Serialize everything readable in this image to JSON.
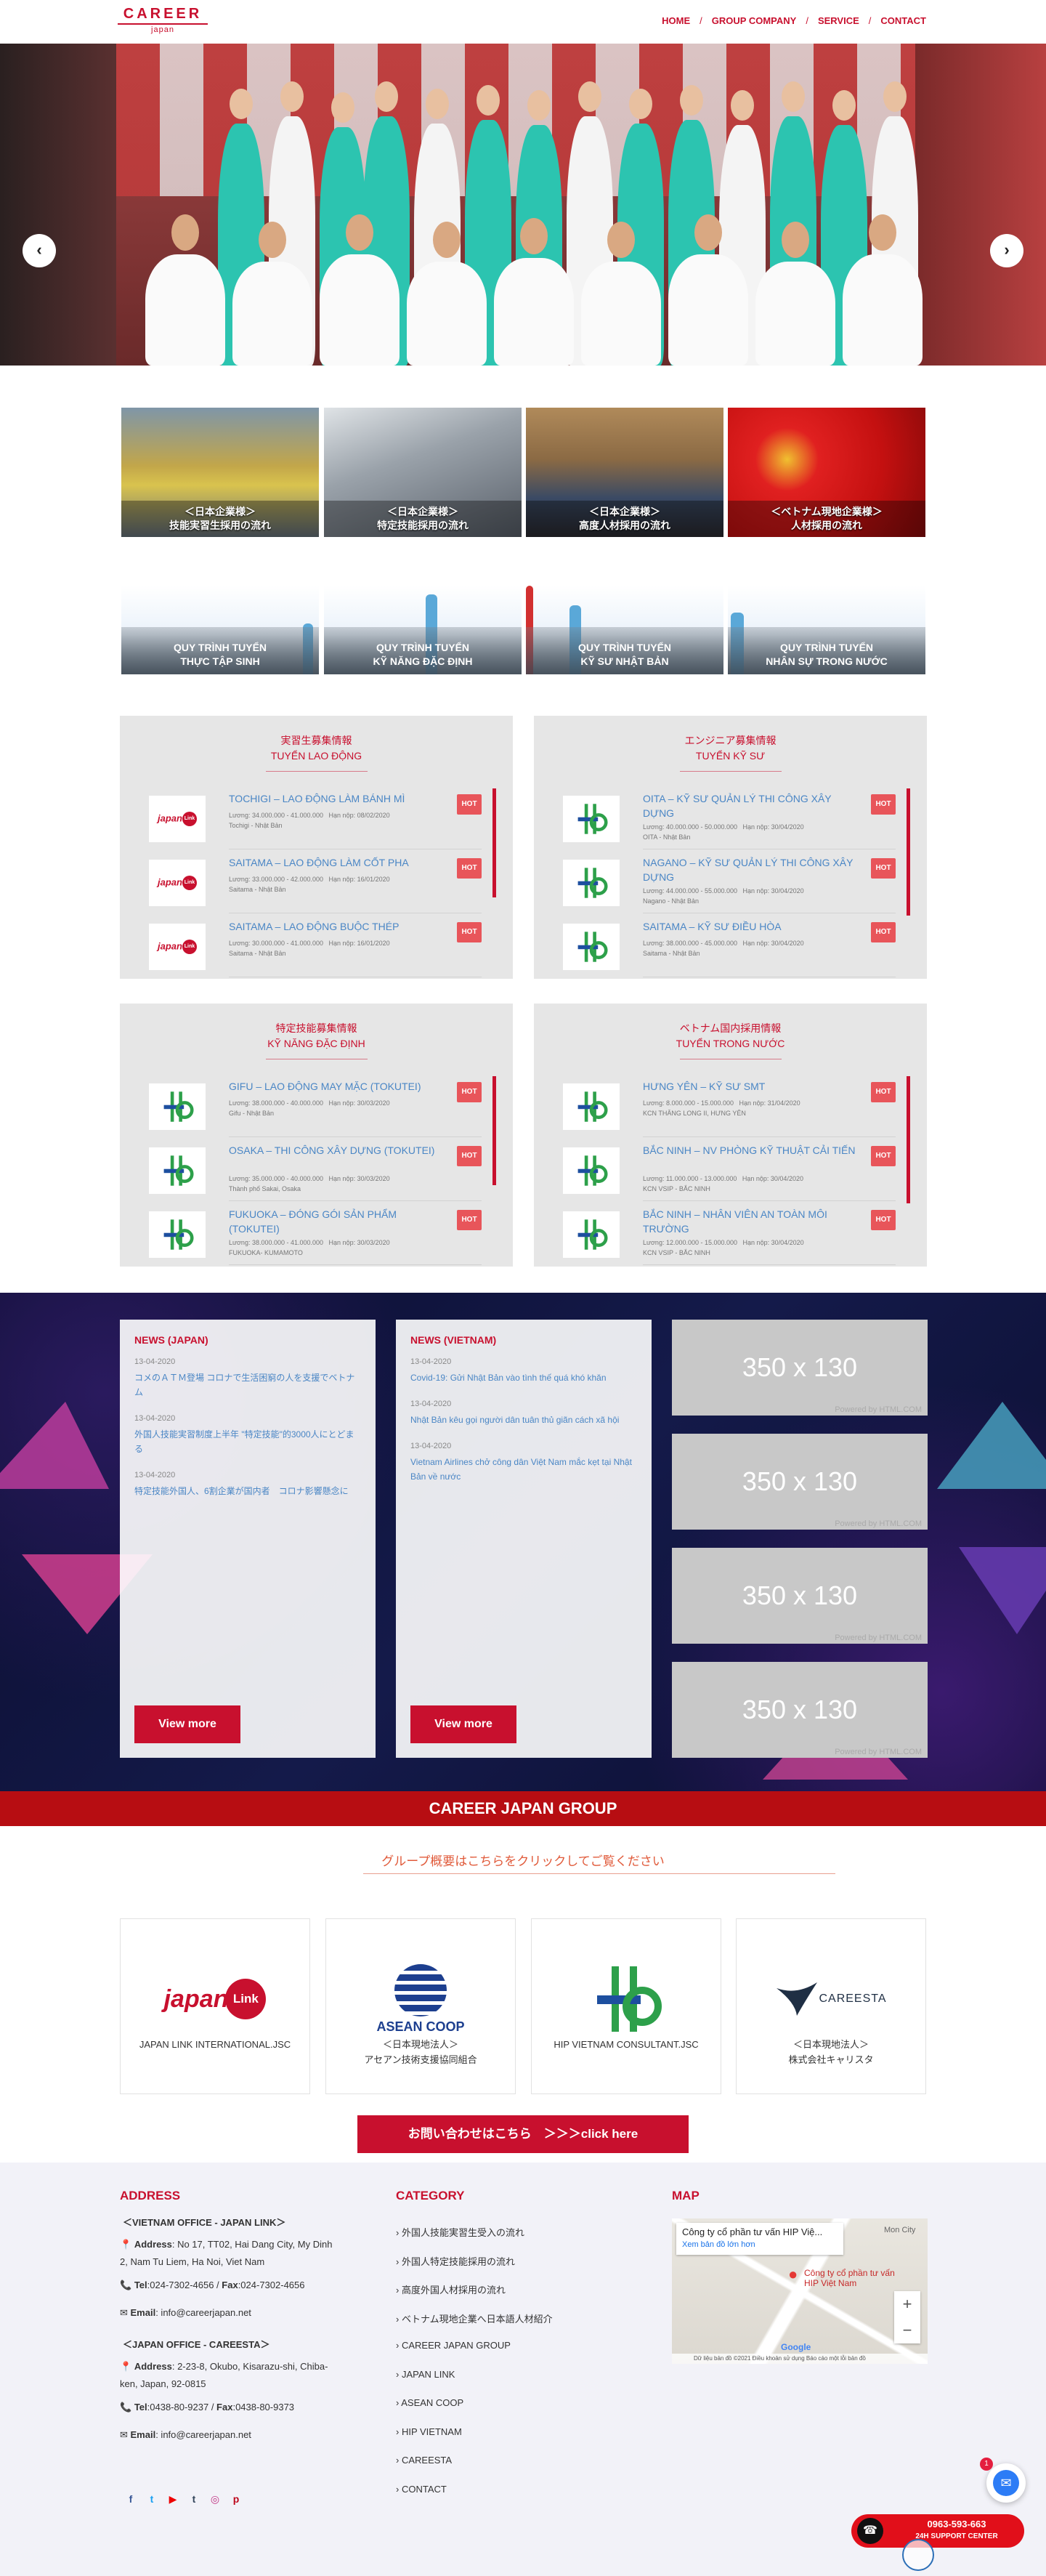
{
  "header": {
    "logo_top": "CAREER",
    "logo_bottom": "japan",
    "nav": [
      "HOME",
      "GROUP COMPANY",
      "SERVICE",
      "CONTACT"
    ]
  },
  "slider": {
    "prev": "‹",
    "next": "›",
    "active_slide": 3,
    "slide_count": 3
  },
  "process_cards": [
    {
      "line1": "＜日本企業様＞",
      "line2": "技能実習生採用の流れ"
    },
    {
      "line1": "＜日本企業様＞",
      "line2": "特定技能採用の流れ"
    },
    {
      "line1": "＜日本企業様＞",
      "line2": "高度人材採用の流れ"
    },
    {
      "line1": "＜ベトナム現地企業様＞",
      "line2": "人材採用の流れ"
    }
  ],
  "quy_cards": [
    {
      "line1": "QUY TRÌNH TUYỂN",
      "line2": "THỰC TẬP SINH"
    },
    {
      "line1": "QUY TRÌNH TUYỂN",
      "line2": "KỸ NĂNG ĐẶC ĐỊNH"
    },
    {
      "line1": "QUY TRÌNH TUYỂN",
      "line2": "KỸ SƯ NHẬT BẢN"
    },
    {
      "line1": "QUY TRÌNH TUYỂN",
      "line2": "NHÂN SỰ TRONG NƯỚC"
    }
  ],
  "job_panels": [
    {
      "title_jp": "実習生募集情報",
      "title_vn": "TUYỂN LAO ĐỘNG",
      "jobs": [
        {
          "title": "TOCHIGI – LAO ĐỘNG LÀM BÁNH MÌ",
          "salary": "Lương: 34.000.000 - 41.000.000",
          "deadline": "Hạn nộp: 08/02/2020",
          "place": "Tochigi - Nhật Bản",
          "logo": "japan"
        },
        {
          "title": "SAITAMA – LAO ĐỘNG LÀM CỐT PHA",
          "salary": "Lương: 33.000.000 - 42.000.000",
          "deadline": "Hạn nộp: 16/01/2020",
          "place": "Saitama - Nhật Bản",
          "logo": "japan"
        },
        {
          "title": "SAITAMA – LAO ĐỘNG BUỘC THÉP",
          "salary": "Lương: 30.000.000 - 41.000.000",
          "deadline": "Hạn nộp: 16/01/2020",
          "place": "Saitama - Nhật Bản",
          "logo": "japan"
        }
      ],
      "hot": "HOT"
    },
    {
      "title_jp": "エンジニア募集情報",
      "title_vn": "TUYỂN KỸ SƯ",
      "jobs": [
        {
          "title": "OITA – KỸ SƯ QUẢN LÝ THI CÔNG XÂY DỰNG",
          "salary": "Lương: 40.000.000 - 50.000.000",
          "deadline": "Hạn nộp: 30/04/2020",
          "place": "OITA - Nhật Bản",
          "logo": "hip"
        },
        {
          "title": "NAGANO – KỸ SƯ QUẢN LÝ THI CÔNG XÂY DỰNG",
          "salary": "Lương: 44.000.000 - 55.000.000",
          "deadline": "Hạn nộp: 30/04/2020",
          "place": "Nagano - Nhật Bản",
          "logo": "hip"
        },
        {
          "title": "SAITAMA – KỸ SƯ ĐIỀU HÒA",
          "salary": "Lương: 38.000.000 - 45.000.000",
          "deadline": "Hạn nộp: 30/04/2020",
          "place": "Saitama - Nhật Bản",
          "logo": "hip"
        }
      ],
      "hot": "HOT"
    },
    {
      "title_jp": "特定技能募集情報",
      "title_vn": "KỸ NĂNG ĐẶC ĐỊNH",
      "jobs": [
        {
          "title": "GIFU – LAO ĐỘNG MAY MẶC (TOKUTEI)",
          "salary": "Lương: 38.000.000 - 40.000.000",
          "deadline": "Hạn nộp: 30/03/2020",
          "place": "Gifu - Nhật Bản",
          "logo": "hip"
        },
        {
          "title": "OSAKA – THI CÔNG XÂY DỰNG (TOKUTEI)",
          "salary": "Lương: 35.000.000 - 40.000.000",
          "deadline": "Hạn nộp: 30/03/2020",
          "place": "Thành phố Sakai, Osaka",
          "logo": "hip"
        },
        {
          "title": "FUKUOKA – ĐÓNG GÓI SẢN PHẨM (TOKUTEI)",
          "salary": "Lương: 38.000.000 - 41.000.000",
          "deadline": "Hạn nộp: 30/03/2020",
          "place": "FUKUOKA- KUMAMOTO",
          "logo": "hip"
        }
      ],
      "hot": "HOT"
    },
    {
      "title_jp": "ベトナム国内採用情報",
      "title_vn": "TUYỂN TRONG NƯỚC",
      "jobs": [
        {
          "title": "HƯNG YÊN – KỸ SƯ SMT",
          "salary": "Lương: 8.000.000 - 15.000.000",
          "deadline": "Hạn nộp: 31/04/2020",
          "place": "KCN THĂNG LONG II, HƯNG YÊN",
          "logo": "hip"
        },
        {
          "title": "BẮC NINH – NV PHÒNG KỸ THUẬT CẢI TIẾN",
          "salary": "Lương: 11.000.000 - 13.000.000",
          "deadline": "Hạn nộp: 30/04/2020",
          "place": "KCN VSIP - BẮC NINH",
          "logo": "hip"
        },
        {
          "title": "BẮC NINH – NHÂN VIÊN AN TOÀN MÔI TRƯỜNG",
          "salary": "Lương: 12.000.000 - 15.000.000",
          "deadline": "Hạn nộp: 30/04/2020",
          "place": "KCN VSIP - BẮC NINH",
          "logo": "hip"
        }
      ],
      "hot": "HOT"
    }
  ],
  "news_japan": {
    "title": "NEWS (JAPAN)",
    "items": [
      {
        "date": "13-04-2020",
        "text": "コメのＡＴＭ登場 コロナで生活困窮の人を支援でベトナム"
      },
      {
        "date": "13-04-2020",
        "text": "外国人技能実習制度上半年 \"特定技能\"的3000人にとどまる"
      },
      {
        "date": "13-04-2020",
        "text": "特定技能外国人、6割企業が国内者　コロナ影響懸念に"
      }
    ],
    "view_more": "View more"
  },
  "news_vietnam": {
    "title": "NEWS (VIETNAM)",
    "items": [
      {
        "date": "13-04-2020",
        "text": "Covid-19: Gửi Nhật Bản vào tình thế quá khó khăn"
      },
      {
        "date": "13-04-2020",
        "text": "Nhật Bản kêu gọi người dân tuân thủ giãn cách xã hội"
      },
      {
        "date": "13-04-2020",
        "text": "Vietnam Airlines chở công dân Việt Nam mắc kẹt tại Nhật Bản về nước"
      }
    ],
    "view_more": "View more"
  },
  "placeholders": {
    "size": "350 x 130",
    "powered": "Powered by HTML.COM"
  },
  "group": {
    "bar_title": "CAREER JAPAN GROUP",
    "link_text": "グループ概要はこちらをクリックしてご覧ください",
    "companies": [
      {
        "name": "JAPAN LINK INTERNATIONAL.JSC",
        "sub": "",
        "logo_text": "japan",
        "logo_badge": "Link"
      },
      {
        "name": "＜日本現地法人＞",
        "sub": "アセアン技術支援協同組合",
        "logo_text": "ASEAN COOP",
        "logo_badge": ""
      },
      {
        "name": "HIP VIETNAM CONSULTANT.JSC",
        "sub": "",
        "logo_text": "",
        "logo_badge": ""
      },
      {
        "name": "＜日本現地法人＞",
        "sub": "株式会社キャリスタ",
        "logo_text": "CAREESTA",
        "logo_badge": ""
      }
    ],
    "contact_button": "お問い合わせはこちら　＞＞＞click here"
  },
  "footer": {
    "address_title": "ADDRESS",
    "office1": "＜VIETNAM OFFICE - JAPAN LINK＞",
    "office1_addr_label": "Address",
    "office1_addr": ": No 17, TT02, Hai Dang City, My Dinh 2, Nam Tu Liem, Ha Noi, Viet Nam",
    "office1_tel_label": "Tel",
    "office1_tel": ":024-7302-4656 / ",
    "office1_fax_label": "Fax",
    "office1_fax": ":024-7302-4656",
    "office1_email_label": "Email",
    "office1_email": ": info@careerjapan.net",
    "office2": "＜JAPAN OFFICE - CAREESTA＞",
    "office2_addr_label": "Address",
    "office2_addr": ": 2-23-8, Okubo, Kisarazu-shi, Chiba-ken, Japan, 92-0815",
    "office2_tel_label": "Tel",
    "office2_tel": ":0438-80-9237 / ",
    "office2_fax_label": "Fax",
    "office2_fax": ":0438-80-9373",
    "office2_email_label": "Email",
    "office2_email": ": info@careerjapan.net",
    "category_title": "CATEGORY",
    "categories": [
      "外国人技能実習生受入の流れ",
      "外国人特定技能採用の流れ",
      "高度外国人材採用の流れ",
      "ベトナム現地企業へ日本語人材紹介",
      "CAREER JAPAN GROUP",
      "JAPAN LINK",
      "ASEAN COOP",
      "HIP VIETNAM",
      "CAREESTA",
      "CONTACT"
    ],
    "map_title": "MAP",
    "map_place": "Công ty cổ phần tư vấn HIP Việ...",
    "map_link": "Xem bản đồ lớn hơn",
    "map_pin": "Công ty cổ phần tư vấn HIP Việt Nam",
    "map_street": "Mon City",
    "map_foot": "Dữ liệu bản đồ ©2021   Điều khoản sử dụng   Báo cáo một lỗi bản đồ",
    "map_google": "Google",
    "map_zoom_in": "+",
    "map_zoom_out": "−"
  },
  "widgets": {
    "fb_badge": "1",
    "hotline_number": "0963-593-663",
    "hotline_label": "24H SUPPORT CENTER"
  },
  "colors": {
    "brand_red": "#c8102e",
    "link_blue": "#4a86c5",
    "hot_red": "#e8555a"
  }
}
